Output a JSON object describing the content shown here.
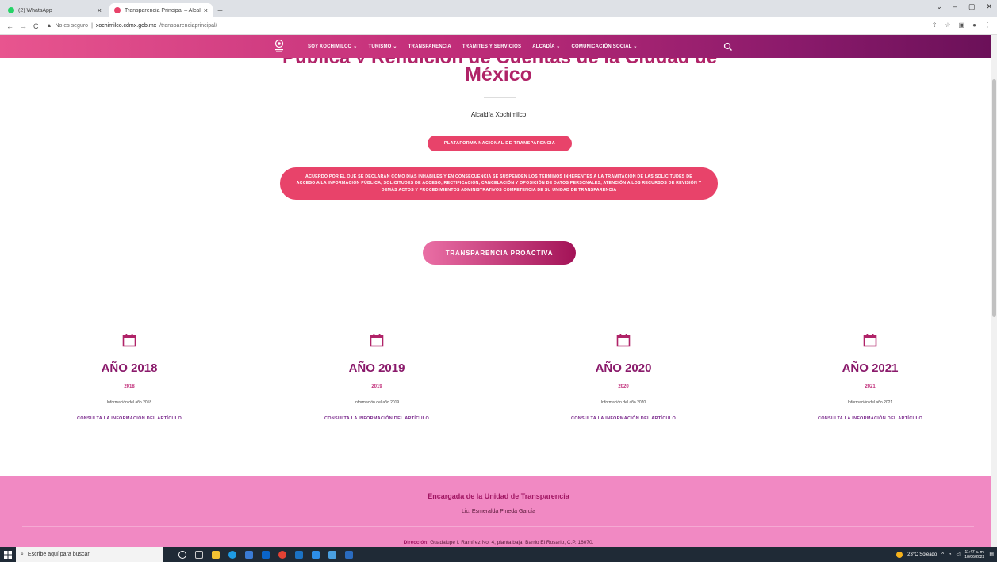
{
  "browser": {
    "tabs": [
      {
        "title": "(2) WhatsApp",
        "active": false,
        "favicon_color": "#25d366"
      },
      {
        "title": "Transparencia Principal – Alcaldía...",
        "active": true,
        "favicon_color": "#e8436a"
      }
    ],
    "new_tab": "+",
    "url_warning": "No es seguro",
    "url_host": "xochimilco.cdmx.gob.mx",
    "url_path": "/transparenciaprincipal/"
  },
  "nav": {
    "items": [
      {
        "label": "SOY XOCHIMILCO",
        "dropdown": true
      },
      {
        "label": "TURISMO",
        "dropdown": true
      },
      {
        "label": "TRANSPARENCIA",
        "dropdown": false
      },
      {
        "label": "TRAMITES Y SERVICIOS",
        "dropdown": false
      },
      {
        "label": "ALCADÍA",
        "dropdown": true
      },
      {
        "label": "COMUNICACIÓN SOCIAL",
        "dropdown": true
      }
    ]
  },
  "hero": {
    "heading_partial": "Pública y Rendición de Cuentas de la Ciudad de",
    "heading": "México",
    "subtitle": "Alcaldía Xochimilco",
    "pnt_button": "PLATAFORMA NACIONAL DE TRANSPARENCIA",
    "acuerdo_button": "ACUERDO POR EL QUE SE DECLARAN COMO DÍAS INHÁBILES Y EN CONSECUENCIA SE SUSPENDEN LOS TÉRMINOS INHERENTES A LA TRAMITACIÓN DE LAS SOLICITUDES DE ACCESO A LA INFORMACIÓN PÚBLICA, SOLICITUDES DE ACCESO, RECTIFICACIÓN, CANCELACIÓN Y OPOSICIÓN DE DATOS PERSONALES, ATENCIÓN A LOS RECURSOS DE REVISIÓN Y DEMÁS ACTOS Y PROCEDIMIENTOS ADMINISTRATIVOS COMPETENCIA DE SU UNIDAD DE TRANSPARENCIA",
    "proactiva_button": "TRANSPARENCIA PROACTIVA"
  },
  "years": [
    {
      "title": "AÑO 2018",
      "sub": "2018",
      "info": "Información del año 2018",
      "link": "CONSULTA LA INFORMACIÓN DEL ARTÍCULO"
    },
    {
      "title": "AÑO 2019",
      "sub": "2019",
      "info": "Información del año 2019",
      "link": "CONSULTA LA INFORMACIÓN DEL ARTÍCULO"
    },
    {
      "title": "AÑO 2020",
      "sub": "2020",
      "info": "Información del año 2020",
      "link": "CONSULTA LA INFORMACIÓN DEL ARTÍCULO"
    },
    {
      "title": "AÑO 2021",
      "sub": "2021",
      "info": "Información del año 2021",
      "link": "CONSULTA LA INFORMACIÓN DEL ARTÍCULO"
    }
  ],
  "footer": {
    "title": "Encargada de la Unidad de Transparencia",
    "name": "Lic. Esmeralda Pineda García",
    "address_label": "Dirección:",
    "address": "Guadalupe I. Ramírez No. 4, planta baja, Barrio El Rosario, C.P. 16070."
  },
  "taskbar": {
    "search_placeholder": "Escribe aquí para buscar",
    "weather": "23°C  Soleado",
    "time": "11:47 a. m.",
    "date": "18/06/2022"
  },
  "colors": {
    "brand": "#b02368",
    "pink_button": "#e8436a",
    "footer_bg": "#f189c3"
  }
}
